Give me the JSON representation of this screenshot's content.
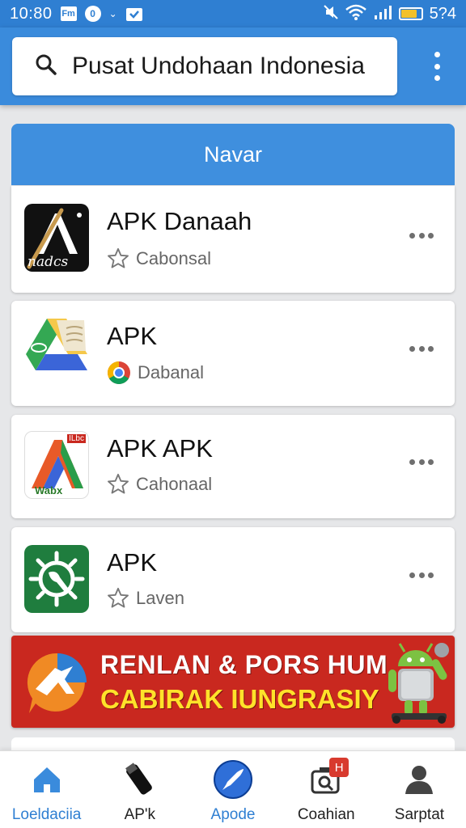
{
  "status_bar": {
    "time": "10:80",
    "notif_box": "Fm",
    "notif_circle": "0",
    "notif_small": "⌄",
    "battery_level": "5?4",
    "battery_fill": 0.8
  },
  "search": {
    "text": "Pusat Undohaan Indonesia"
  },
  "section": {
    "title": "Navar"
  },
  "apps": [
    {
      "name": "APK Danaah",
      "sub": "Cabonsal",
      "icon_label": "nadcs",
      "sub_icon": "star-icon"
    },
    {
      "name": "APK",
      "sub": "Dabanal",
      "sub_icon": "chrome-icon"
    },
    {
      "name": "APK APK",
      "sub": "Cahonaal",
      "icon_label": "Wabx",
      "icon_tag": "ILbc",
      "sub_icon": "star-icon"
    },
    {
      "name": "APK",
      "sub": "Laven",
      "sub_icon": "star-icon"
    }
  ],
  "banner": {
    "line1": "RENLAN & PORS HUM",
    "line2": "CABIRAK IUNGRASIY"
  },
  "nav": [
    {
      "label": "Loeldaciia",
      "icon": "home-icon",
      "active": true
    },
    {
      "label": "AP'k",
      "icon": "usb-drive-icon",
      "active": false
    },
    {
      "label": "Apode",
      "icon": "rocket-icon",
      "active": true
    },
    {
      "label": "Coahian",
      "icon": "camera-search-icon",
      "badge": "H",
      "active": false
    },
    {
      "label": "Sarptat",
      "icon": "person-icon",
      "active": false
    }
  ],
  "colors": {
    "primary": "#3a8bdc",
    "banner": "#c9281f",
    "banner_text2": "#ffe22a"
  }
}
